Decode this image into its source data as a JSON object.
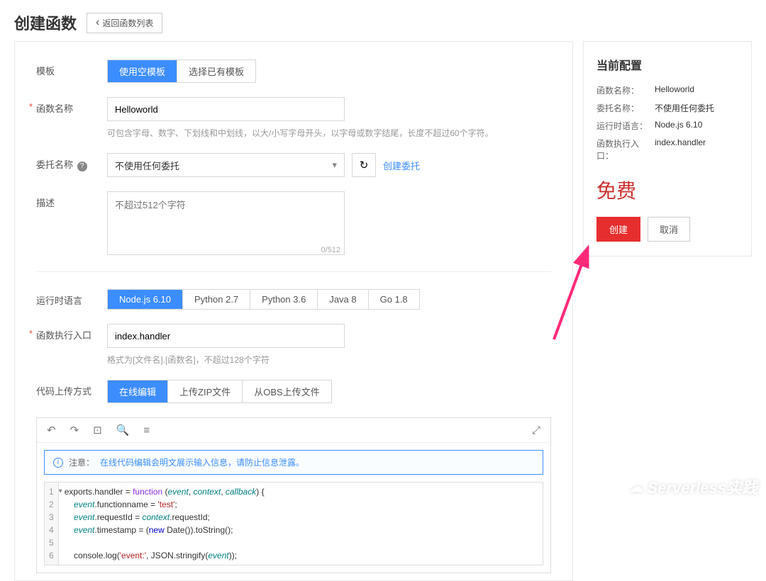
{
  "header": {
    "title": "创建函数",
    "back_label": "返回函数列表"
  },
  "form": {
    "template": {
      "label": "模板",
      "opt_blank": "使用空模板",
      "opt_existing": "选择已有模板"
    },
    "name": {
      "label": "函数名称",
      "value": "Helloworld",
      "hint": "可包含字母、数字、下划线和中划线，以大/小写字母开头，以字母或数字结尾，长度不超过60个字符。"
    },
    "agency": {
      "label": "委托名称",
      "value": "不使用任何委托",
      "create_link": "创建委托"
    },
    "description": {
      "label": "描述",
      "placeholder": "不超过512个字符",
      "counter": "0/512"
    },
    "runtime": {
      "label": "运行时语言",
      "opts": [
        "Node.js 6.10",
        "Python 2.7",
        "Python 3.6",
        "Java 8",
        "Go 1.8"
      ]
    },
    "handler": {
      "label": "函数执行入口",
      "value": "index.handler",
      "hint": "格式为[文件名].[函数名]，不超过128个字符"
    },
    "upload": {
      "label": "代码上传方式",
      "opt_online": "在线编辑",
      "opt_zip": "上传ZIP文件",
      "opt_obs": "从OBS上传文件"
    }
  },
  "editor": {
    "notice_label": "注意：",
    "notice_text": "在线代码编辑会明文展示输入信息，请防止信息泄露。",
    "code": {
      "l1a": "exports.handler = ",
      "l1b": "function",
      "l1c": " (",
      "l1d": "event",
      "l1e": ", ",
      "l1f": "context",
      "l1g": ", ",
      "l1h": "callback",
      "l1i": ") {",
      "l2a": "    ",
      "l2b": "event",
      "l2c": ".functionname = ",
      "l2d": "'test'",
      "l2e": ";",
      "l3a": "    ",
      "l3b": "event",
      "l3c": ".requestId = ",
      "l3d": "context",
      "l3e": ".requestId;",
      "l4a": "    ",
      "l4b": "event",
      "l4c": ".timestamp = (",
      "l4d": "new",
      "l4e": " Date()).toString();",
      "l5": "",
      "l6a": "    console.log(",
      "l6b": "'event:'",
      "l6c": ", JSON.stringify(",
      "l6d": "event",
      "l6e": "));"
    }
  },
  "side": {
    "title": "当前配置",
    "rows": {
      "name_label": "函数名称：",
      "name_value": "Helloworld",
      "agency_label": "委托名称：",
      "agency_value": "不使用任何委托",
      "runtime_label": "运行时语言：",
      "runtime_value": "Node.js 6.10",
      "handler_label": "函数执行入口：",
      "handler_value": "index.handler"
    },
    "free": "免费",
    "create_btn": "创建",
    "cancel_btn": "取消"
  },
  "watermark": "Serverless实践"
}
